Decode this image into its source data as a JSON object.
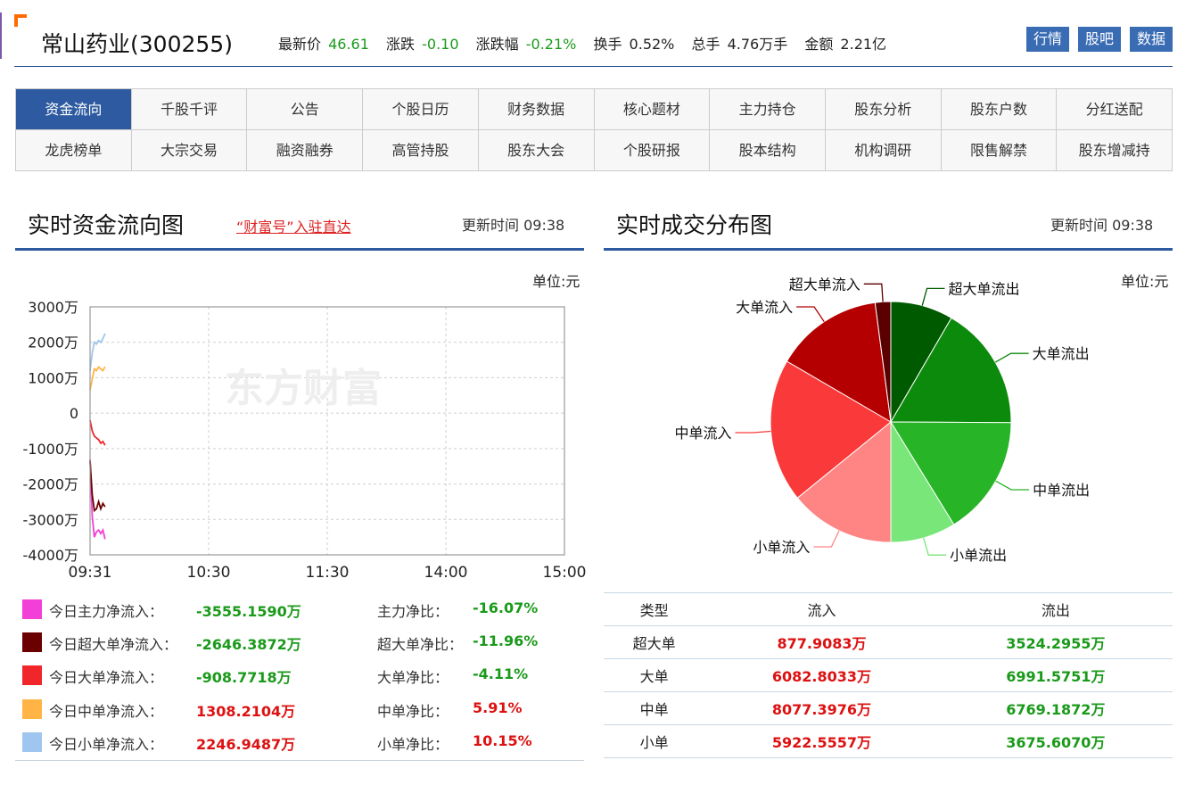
{
  "header": {
    "stock_name": "常山药业(300255)",
    "quote": {
      "latest_label": "最新价",
      "latest_value": "46.61",
      "change_label": "涨跌",
      "change_value": "-0.10",
      "pct_label": "涨跌幅",
      "pct_value": "-0.21%",
      "turnover_label": "换手",
      "turnover_value": "0.52%",
      "volume_label": "总手",
      "volume_value": "4.76万手",
      "amount_label": "金额",
      "amount_value": "2.21亿"
    },
    "buttons": [
      "行情",
      "股吧",
      "数据"
    ]
  },
  "nav": {
    "row1": [
      "资金流向",
      "千股千评",
      "公告",
      "个股日历",
      "财务数据",
      "核心题材",
      "主力持仓",
      "股东分析",
      "股东户数",
      "分红送配"
    ],
    "row2": [
      "龙虎榜单",
      "大宗交易",
      "融资融券",
      "高管持股",
      "股东大会",
      "个股研报",
      "股本结构",
      "机构调研",
      "限售解禁",
      "股东增减持"
    ],
    "active": "资金流向"
  },
  "flow_panel": {
    "title": "实时资金流向图",
    "promo": "“财富号”入驻直达",
    "update_label": "更新时间",
    "update_time": "09:38",
    "unit": "单位:元",
    "watermark": "东方财富"
  },
  "dist_panel": {
    "title": "实时成交分布图",
    "update_label": "更新时间",
    "update_time": "09:38",
    "unit": "单位:元"
  },
  "legend": [
    {
      "label": "今日主力净流入：",
      "value": "-3555.1590万",
      "ratio_label": "主力净比：",
      "ratio": "-16.07%",
      "color": "#f23fd8",
      "value_color": "#1a9a1a",
      "ratio_color": "#1a9a1a"
    },
    {
      "label": "今日超大单净流入：",
      "value": "-2646.3872万",
      "ratio_label": "超大单净比：",
      "ratio": "-11.96%",
      "color": "#6b0000",
      "value_color": "#1a9a1a",
      "ratio_color": "#1a9a1a"
    },
    {
      "label": "今日大单净流入：",
      "value": "-908.7718万",
      "ratio_label": "大单净比：",
      "ratio": "-4.11%",
      "color": "#f0262b",
      "value_color": "#1a9a1a",
      "ratio_color": "#1a9a1a"
    },
    {
      "label": "今日中单净流入：",
      "value": "1308.2104万",
      "ratio_label": "中单净比：",
      "ratio": "5.91%",
      "color": "#ffb445",
      "value_color": "#dd1111",
      "ratio_color": "#dd1111"
    },
    {
      "label": "今日小单净流入：",
      "value": "2246.9487万",
      "ratio_label": "小单净比：",
      "ratio": "10.15%",
      "color": "#9ec6ee",
      "value_color": "#dd1111",
      "ratio_color": "#dd1111"
    }
  ],
  "dist_table": {
    "headers": [
      "类型",
      "流入",
      "流出"
    ],
    "rows": [
      {
        "type": "超大单",
        "in": "877.9083万",
        "out": "3524.2955万"
      },
      {
        "type": "大单",
        "in": "6082.8033万",
        "out": "6991.5751万"
      },
      {
        "type": "中单",
        "in": "8077.3976万",
        "out": "6769.1872万"
      },
      {
        "type": "小单",
        "in": "5922.5557万",
        "out": "3675.6070万"
      }
    ]
  },
  "chart_data": [
    {
      "type": "line",
      "title": "实时资金流向图",
      "x_ticks": [
        "09:31",
        "10:30",
        "11:30",
        "14:00",
        "15:00"
      ],
      "y_ticks": [
        "3000万",
        "2000万",
        "1000万",
        "0",
        "-1000万",
        "-2000万",
        "-3000万",
        "-4000万"
      ],
      "ylim": [
        -4000,
        3000
      ],
      "y_unit": "万",
      "grid": true,
      "x": [
        "09:31",
        "09:32",
        "09:33",
        "09:34",
        "09:35",
        "09:36",
        "09:37",
        "09:38"
      ],
      "series": [
        {
          "color": "#f23fd8",
          "values": [
            -1300,
            -2900,
            -3500,
            -3350,
            -3300,
            -3400,
            -3300,
            -3555
          ]
        },
        {
          "color": "#6b0000",
          "values": [
            -1350,
            -2300,
            -2750,
            -2700,
            -2500,
            -2700,
            -2550,
            -2646
          ]
        },
        {
          "color": "#f0262b",
          "values": [
            -200,
            -500,
            -650,
            -700,
            -750,
            -850,
            -800,
            -909
          ]
        },
        {
          "color": "#ffb445",
          "values": [
            650,
            950,
            1250,
            1200,
            1300,
            1250,
            1200,
            1308
          ]
        },
        {
          "color": "#9ec6ee",
          "values": [
            1200,
            1700,
            2000,
            1950,
            2050,
            2000,
            2100,
            2247
          ]
        }
      ]
    },
    {
      "type": "pie",
      "title": "实时成交分布图",
      "categories": [
        "超大单流出",
        "大单流出",
        "中单流出",
        "小单流出",
        "小单流入",
        "中单流入",
        "大单流入",
        "超大单流入"
      ],
      "values": [
        3524.2955,
        6991.5751,
        6769.1872,
        3675.607,
        5922.5557,
        8077.3976,
        6082.8033,
        877.9083
      ],
      "colors": [
        "#005a00",
        "#0c8a0c",
        "#27b427",
        "#78e678",
        "#ff8484",
        "#fa3a3a",
        "#b40000",
        "#5a0000"
      ]
    }
  ]
}
